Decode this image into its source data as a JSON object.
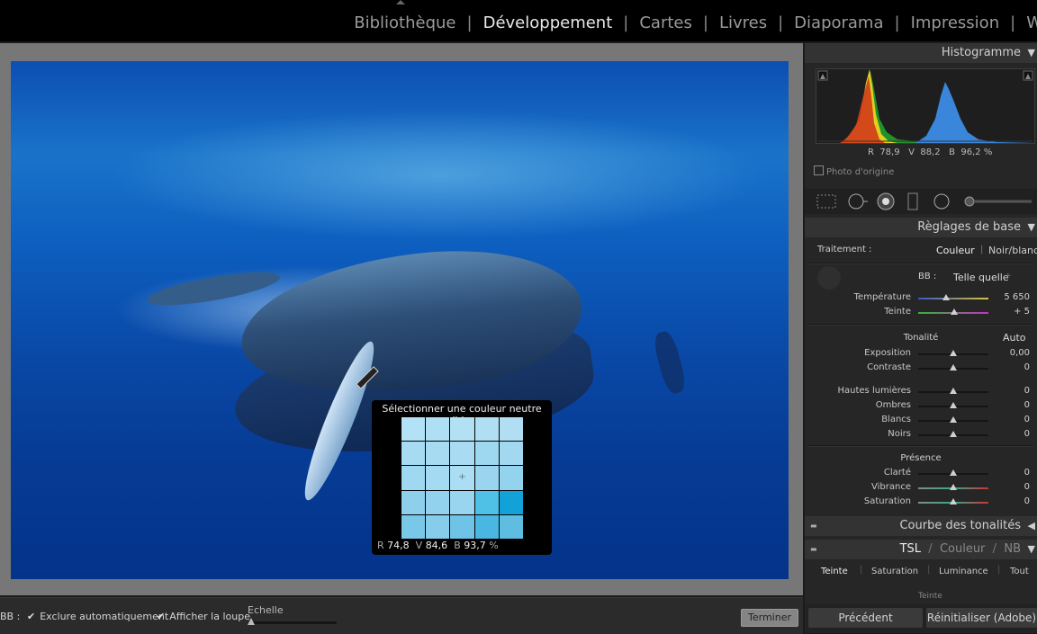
{
  "modules": [
    "Bibliothèque",
    "Développement",
    "Cartes",
    "Livres",
    "Diaporama",
    "Impression",
    "W"
  ],
  "modules_active": "Développement",
  "loupe": {
    "title": "Sélectionner une couleur neutre cible :",
    "readout": {
      "r_label": "R",
      "r": "74,8",
      "v_label": "V",
      "v": "84,6",
      "b_label": "B",
      "b": "93,7",
      "unit": "%"
    },
    "swatches": [
      "#b3e1f5",
      "#afdff4",
      "#b3e1f4",
      "#b0def3",
      "#b1def3",
      "#a6dbf2",
      "#a7dbf2",
      "#a9dcf2",
      "#9dd7f0",
      "#a3d8f1",
      "#9fd8f1",
      "#a4daf2",
      "#abddf3",
      "#99d5ef",
      "#94d3ee",
      "#8ed0ec",
      "#93d2ee",
      "#9ad5ef",
      "#4fc0e6",
      "#12a2d8",
      "#7ac8e8",
      "#86cdec",
      "#6ec3e6",
      "#4ab7e2",
      "#5fbde2"
    ]
  },
  "toolbar": {
    "bb_label": "BB :",
    "auto_exclude_label": "Exclure automatiquement",
    "show_loupe_label": "Afficher la loupe",
    "scale_label": "Echelle",
    "done_label": "Terminer"
  },
  "right_panel": {
    "histogram": {
      "title": "Histogramme",
      "readout": {
        "r_label": "R",
        "r": "78,9",
        "v_label": "V",
        "v": "88,2",
        "b_label": "B",
        "b": "96,2",
        "unit": "%"
      },
      "original_photo_label": "Photo d'origine"
    },
    "basic": {
      "title": "Règlages de base",
      "treatment_label": "Traitement :",
      "color_option": "Couleur",
      "bw_option": "Noir/blanc",
      "wb_label": "BB :",
      "wb_value": "Telle quelle",
      "temperature_label": "Température",
      "temperature_value": "5 650",
      "tint_label": "Teinte",
      "tint_value": "+ 5",
      "tone_title": "Tonalité",
      "auto_label": "Auto",
      "exposure_label": "Exposition",
      "exposure_value": "0,00",
      "contrast_label": "Contraste",
      "contrast_value": "0",
      "highlights_label": "Hautes lumières",
      "highlights_value": "0",
      "shadows_label": "Ombres",
      "shadows_value": "0",
      "whites_label": "Blancs",
      "whites_value": "0",
      "blacks_label": "Noirs",
      "blacks_value": "0",
      "presence_title": "Présence",
      "clarity_label": "Clarté",
      "clarity_value": "0",
      "vibrance_label": "Vibrance",
      "vibrance_value": "0",
      "saturation_label": "Saturation",
      "saturation_value": "0"
    },
    "tone_curve_title": "Courbe des tonalités",
    "tsl": {
      "title_tsl": "TSL",
      "title_color": "Couleur",
      "title_nb": "NB",
      "tabs": [
        "Teinte",
        "Saturation",
        "Luminance",
        "Tout"
      ],
      "sub_label": "Teinte"
    },
    "buttons": {
      "previous": "Précédent",
      "reset": "Réinitialiser (Adobe)"
    }
  }
}
